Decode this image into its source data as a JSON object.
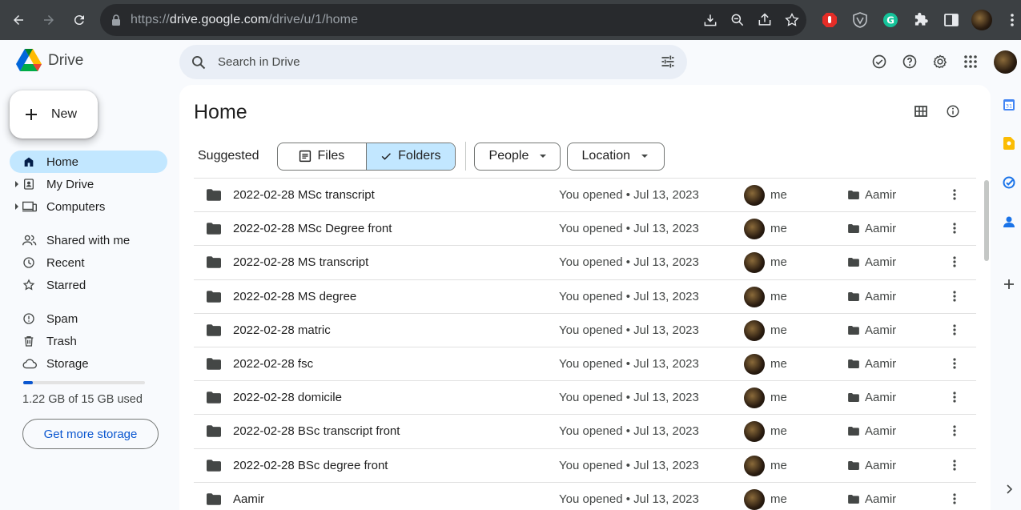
{
  "browser": {
    "url_prefix": "https://",
    "url_host": "drive.google.com",
    "url_path": "/drive/u/1/home"
  },
  "app": {
    "name": "Drive",
    "search_placeholder": "Search in Drive"
  },
  "sidebar": {
    "new_label": "New",
    "items": [
      {
        "label": "Home",
        "icon": "home-icon",
        "active": true
      },
      {
        "label": "My Drive",
        "icon": "my-drive-icon",
        "expandable": true
      },
      {
        "label": "Computers",
        "icon": "computers-icon",
        "expandable": true
      },
      {
        "label": "Shared with me",
        "icon": "shared-icon"
      },
      {
        "label": "Recent",
        "icon": "clock-icon"
      },
      {
        "label": "Starred",
        "icon": "star-icon"
      },
      {
        "label": "Spam",
        "icon": "spam-icon"
      },
      {
        "label": "Trash",
        "icon": "trash-icon"
      },
      {
        "label": "Storage",
        "icon": "cloud-icon"
      }
    ],
    "storage_text": "1.22 GB of 15 GB used",
    "storage_used_fraction": 0.081,
    "get_storage_label": "Get more storage"
  },
  "main": {
    "title": "Home",
    "suggested_label": "Suggested",
    "toggle_files": "Files",
    "toggle_folders": "Folders",
    "filter_people": "People",
    "filter_location": "Location",
    "rows": [
      {
        "name": "2022-02-28 MSc transcript",
        "opened": "You opened • Jul 13, 2023",
        "owner": "me",
        "location": "Aamir"
      },
      {
        "name": "2022-02-28 MSc Degree front",
        "opened": "You opened • Jul 13, 2023",
        "owner": "me",
        "location": "Aamir"
      },
      {
        "name": "2022-02-28 MS transcript",
        "opened": "You opened • Jul 13, 2023",
        "owner": "me",
        "location": "Aamir"
      },
      {
        "name": "2022-02-28 MS degree",
        "opened": "You opened • Jul 13, 2023",
        "owner": "me",
        "location": "Aamir"
      },
      {
        "name": "2022-02-28 matric",
        "opened": "You opened • Jul 13, 2023",
        "owner": "me",
        "location": "Aamir"
      },
      {
        "name": "2022-02-28 fsc",
        "opened": "You opened • Jul 13, 2023",
        "owner": "me",
        "location": "Aamir"
      },
      {
        "name": "2022-02-28 domicile",
        "opened": "You opened • Jul 13, 2023",
        "owner": "me",
        "location": "Aamir"
      },
      {
        "name": "2022-02-28 BSc transcript front",
        "opened": "You opened • Jul 13, 2023",
        "owner": "me",
        "location": "Aamir"
      },
      {
        "name": "2022-02-28 BSc degree front",
        "opened": "You opened • Jul 13, 2023",
        "owner": "me",
        "location": "Aamir"
      },
      {
        "name": "Aamir",
        "opened": "You opened • Jul 13, 2023",
        "owner": "me",
        "location": "Aamir"
      }
    ]
  },
  "colors": {
    "accent": "#0b57d0",
    "active_bg": "#c2e7ff",
    "chrome_bg": "#3c4043"
  }
}
